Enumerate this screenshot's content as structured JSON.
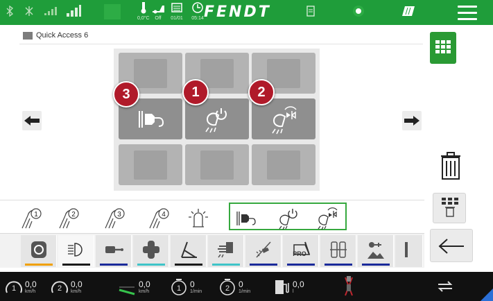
{
  "topbar": {
    "brand": "FENDT",
    "temperature": "0,0°C",
    "status_off": "Off",
    "date": "01/01",
    "time": "05:14"
  },
  "header": {
    "title": "Quick Access 6"
  },
  "tiles": {
    "badges": [
      "3",
      "1",
      "2"
    ],
    "icons": [
      "plug-icon",
      "work-light-power-icon",
      "work-light-auto-icon"
    ]
  },
  "function_buttons": [
    {
      "name": "headland-sequence-1",
      "label": "1"
    },
    {
      "name": "headland-sequence-2",
      "label": "2"
    },
    {
      "name": "headland-sequence-3",
      "label": "3"
    },
    {
      "name": "headland-sequence-4",
      "label": "4"
    },
    {
      "name": "beacon-light",
      "label": ""
    },
    {
      "name": "plug",
      "label": ""
    },
    {
      "name": "work-light-power",
      "label": ""
    },
    {
      "name": "work-light-auto",
      "label": ""
    }
  ],
  "tabs": {
    "icons": [
      "engine-icon",
      "headlight-icon",
      "rear-linkage-icon",
      "front-linkage-icon",
      "drawbar-icon",
      "hydraulic-icon",
      "spray-icon",
      "pro-icon",
      "tyre-pressure-icon",
      "terrain-icon"
    ],
    "underline_colors": [
      "#f0a000",
      "#1a1a1a",
      "#1a2a9a",
      "#3fc4c8",
      "#1a1a1a",
      "#3fc4c8",
      "#1a2a9a",
      "#1a2a9a",
      "#1a2a9a",
      "#1a2a9a"
    ],
    "pro_label": "PRO"
  },
  "bottombar": {
    "gauges": [
      {
        "value": "0,0",
        "unit": "km/h",
        "number": "1"
      },
      {
        "value": "0,0",
        "unit": "km/h",
        "number": "2"
      },
      {
        "value": "0,0",
        "unit": "km/h",
        "number": ""
      },
      {
        "value": "0",
        "unit": "1/min",
        "number": "1"
      },
      {
        "value": "0",
        "unit": "1/min",
        "number": "2"
      },
      {
        "value": "0,0",
        "unit": "l",
        "number": ""
      }
    ]
  },
  "colors": {
    "accent": "#1f9d3a",
    "badge": "#b01a2a"
  }
}
